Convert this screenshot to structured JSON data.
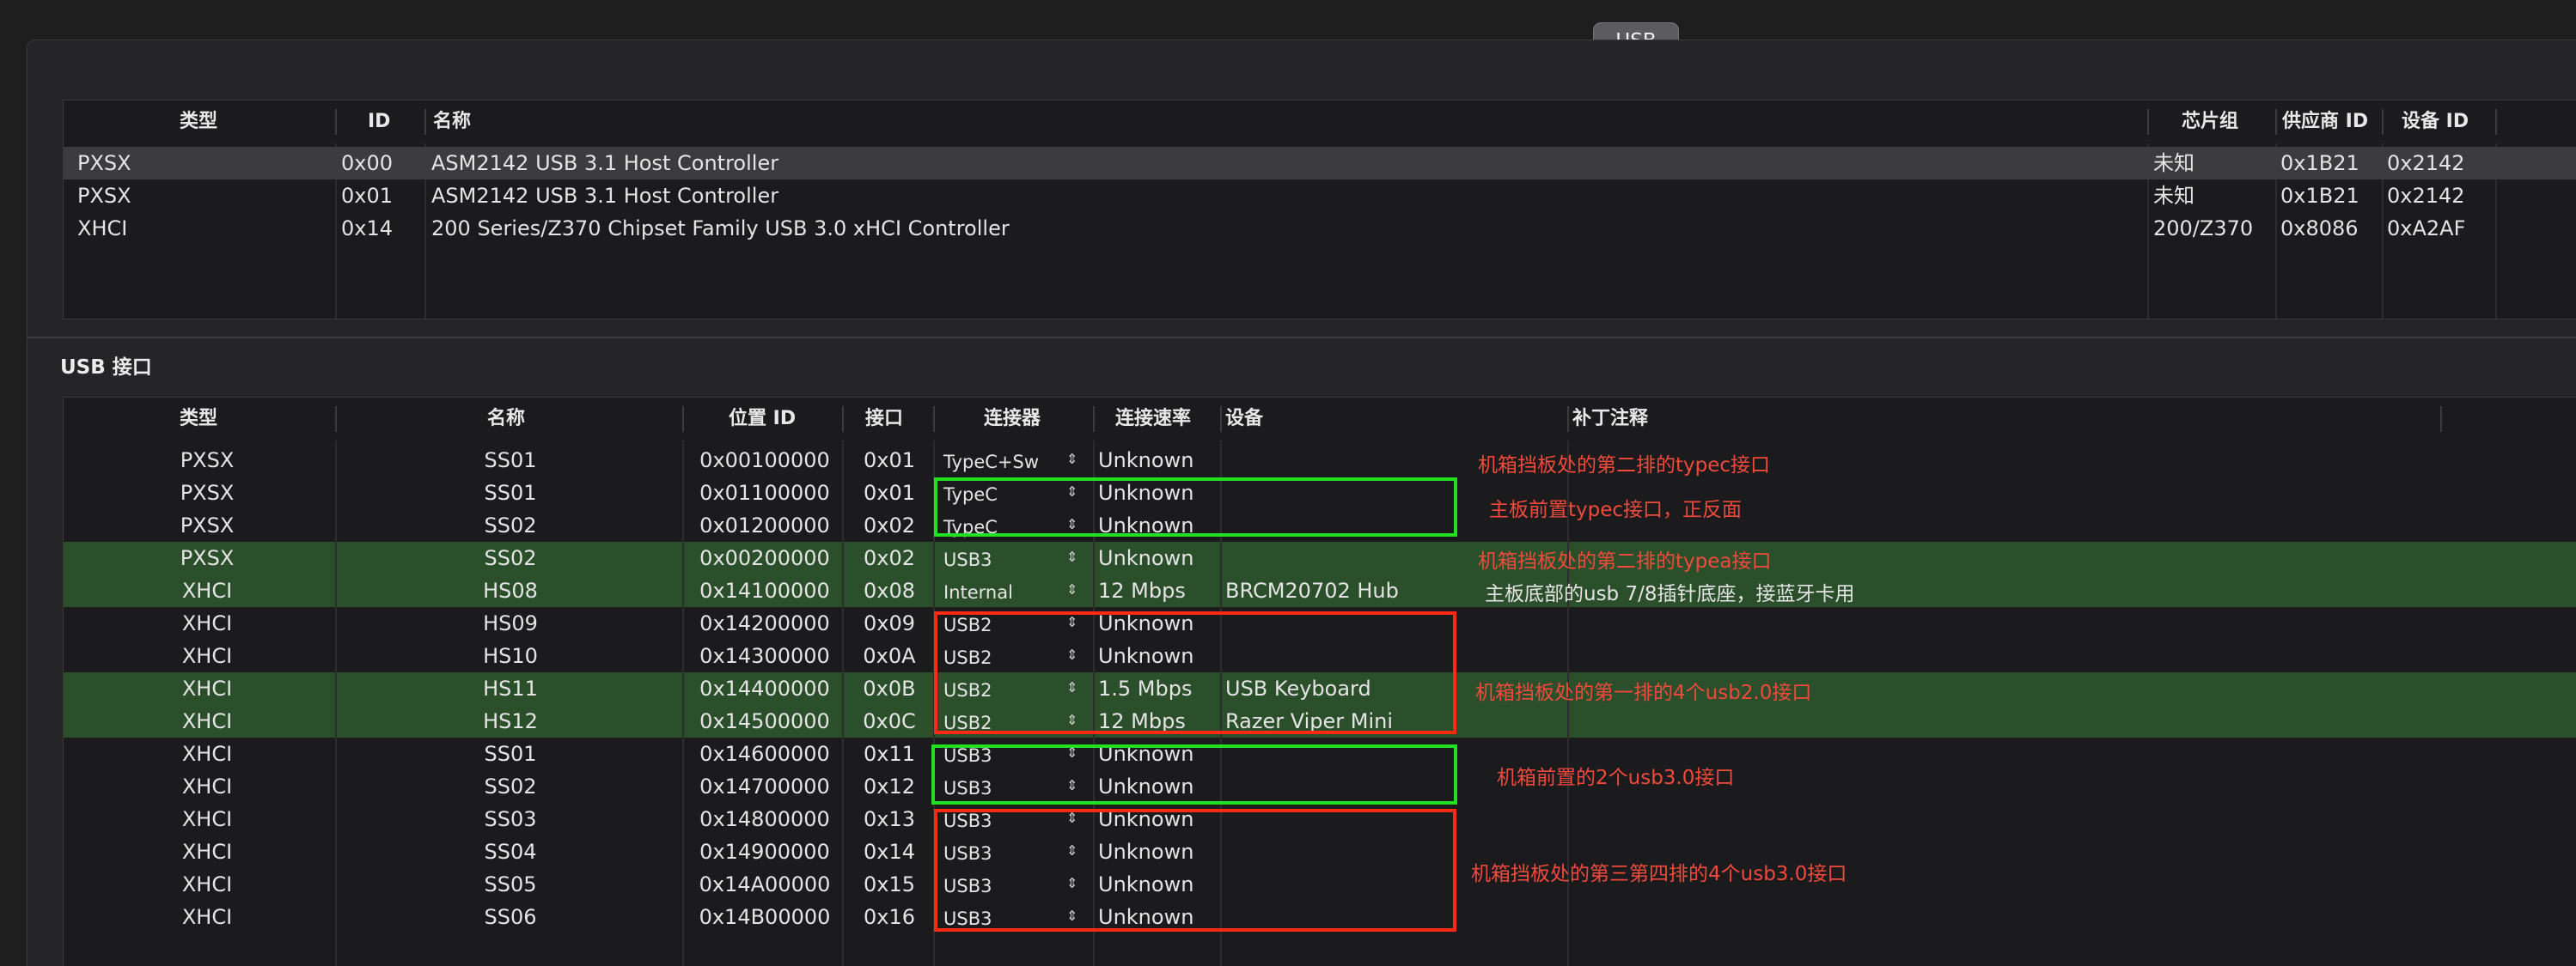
{
  "tab": {
    "label": "USB"
  },
  "controllers": {
    "headers": {
      "type": "类型",
      "id": "ID",
      "name": "名称",
      "chipset": "芯片组",
      "vendor": "供应商 ID",
      "device": "设备 ID"
    },
    "rows": [
      {
        "type": "PXSX",
        "id": "0x00",
        "name": "ASM2142 USB 3.1 Host Controller",
        "chipset": "未知",
        "vendor": "0x1B21",
        "device": "0x2142"
      },
      {
        "type": "PXSX",
        "id": "0x01",
        "name": "ASM2142 USB 3.1 Host Controller",
        "chipset": "未知",
        "vendor": "0x1B21",
        "device": "0x2142"
      },
      {
        "type": "XHCI",
        "id": "0x14",
        "name": "200 Series/Z370 Chipset Family USB 3.0 xHCI Controller",
        "chipset": "200/Z370",
        "vendor": "0x8086",
        "device": "0xA2AF"
      }
    ]
  },
  "ports": {
    "title": "USB 接口",
    "headers": {
      "type": "类型",
      "name": "名称",
      "location": "位置 ID",
      "port": "接口",
      "connector": "连接器",
      "speed": "连接速率",
      "device": "设备",
      "comment": "补丁注释"
    },
    "rows": [
      {
        "type": "PXSX",
        "name": "SS01",
        "location": "0x00100000",
        "port": "0x01",
        "connector": "TypeC+Sw",
        "speed": "Unknown",
        "device": ""
      },
      {
        "type": "PXSX",
        "name": "SS01",
        "location": "0x01100000",
        "port": "0x01",
        "connector": "TypeC",
        "speed": "Unknown",
        "device": ""
      },
      {
        "type": "PXSX",
        "name": "SS02",
        "location": "0x01200000",
        "port": "0x02",
        "connector": "TypeC",
        "speed": "Unknown",
        "device": ""
      },
      {
        "type": "PXSX",
        "name": "SS02",
        "location": "0x00200000",
        "port": "0x02",
        "connector": "USB3",
        "speed": "Unknown",
        "device": ""
      },
      {
        "type": "XHCI",
        "name": "HS08",
        "location": "0x14100000",
        "port": "0x08",
        "connector": "Internal",
        "speed": "12 Mbps",
        "device": "BRCM20702 Hub"
      },
      {
        "type": "XHCI",
        "name": "HS09",
        "location": "0x14200000",
        "port": "0x09",
        "connector": "USB2",
        "speed": "Unknown",
        "device": ""
      },
      {
        "type": "XHCI",
        "name": "HS10",
        "location": "0x14300000",
        "port": "0x0A",
        "connector": "USB2",
        "speed": "Unknown",
        "device": ""
      },
      {
        "type": "XHCI",
        "name": "HS11",
        "location": "0x14400000",
        "port": "0x0B",
        "connector": "USB2",
        "speed": "1.5 Mbps",
        "device": "USB Keyboard"
      },
      {
        "type": "XHCI",
        "name": "HS12",
        "location": "0x14500000",
        "port": "0x0C",
        "connector": "USB2",
        "speed": "12 Mbps",
        "device": "Razer Viper Mini"
      },
      {
        "type": "XHCI",
        "name": "SS01",
        "location": "0x14600000",
        "port": "0x11",
        "connector": "USB3",
        "speed": "Unknown",
        "device": ""
      },
      {
        "type": "XHCI",
        "name": "SS02",
        "location": "0x14700000",
        "port": "0x12",
        "connector": "USB3",
        "speed": "Unknown",
        "device": ""
      },
      {
        "type": "XHCI",
        "name": "SS03",
        "location": "0x14800000",
        "port": "0x13",
        "connector": "USB3",
        "speed": "Unknown",
        "device": ""
      },
      {
        "type": "XHCI",
        "name": "SS04",
        "location": "0x14900000",
        "port": "0x14",
        "connector": "USB3",
        "speed": "Unknown",
        "device": ""
      },
      {
        "type": "XHCI",
        "name": "SS05",
        "location": "0x14A00000",
        "port": "0x15",
        "connector": "USB3",
        "speed": "Unknown",
        "device": ""
      },
      {
        "type": "XHCI",
        "name": "SS06",
        "location": "0x14B00000",
        "port": "0x16",
        "connector": "USB3",
        "speed": "Unknown",
        "device": ""
      }
    ],
    "highlighted_rows": [
      3,
      4,
      7,
      8
    ]
  },
  "annotations": [
    {
      "text": "机箱挡板处的第二排的typec接口",
      "color": "red"
    },
    {
      "text": "主板前置typec接口，正反面",
      "color": "red"
    },
    {
      "text": "机箱挡板处的第二排的typea接口",
      "color": "red"
    },
    {
      "text": "主板底部的usb 7/8插针底座，接蓝牙卡用",
      "color": "white"
    },
    {
      "text": "机箱挡板处的第一排的4个usb2.0接口",
      "color": "red"
    },
    {
      "text": "机箱前置的2个usb3.0接口",
      "color": "red"
    },
    {
      "text": "机箱挡板处的第三第四排的4个usb3.0接口",
      "color": "red"
    }
  ],
  "colors": {
    "row_highlight": "#2b4f2b",
    "box_green": "#22e022",
    "box_red": "#ff2a14",
    "note_red": "#f04a3c"
  }
}
